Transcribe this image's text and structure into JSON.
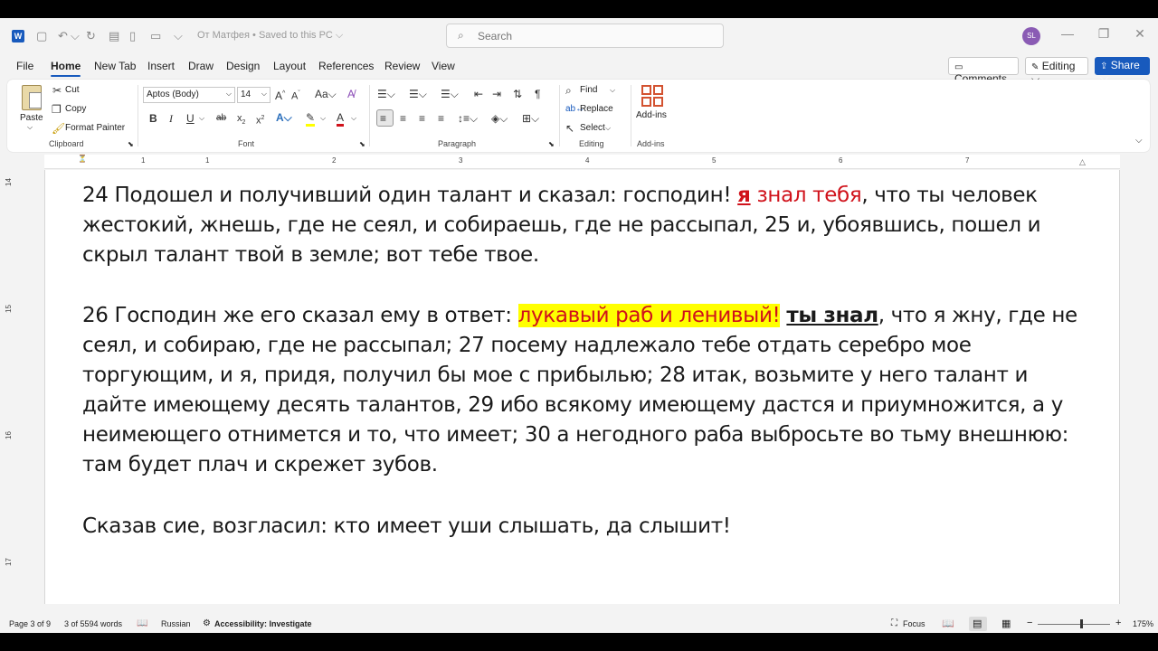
{
  "title_bar": {
    "doc_title": "От Матфея  •  Saved to this PC ⌵",
    "search_placeholder": "Search",
    "avatar_initials": "SL"
  },
  "menu": {
    "tabs": [
      "File",
      "Home",
      "New Tab",
      "Insert",
      "Draw",
      "Design",
      "Layout",
      "References",
      "Review",
      "View"
    ],
    "active_tab": "Home",
    "comments_label": "Comments",
    "editing_label": "Editing ⌵",
    "share_label": "Share ⌵"
  },
  "ribbon": {
    "clipboard": {
      "paste": "Paste",
      "cut": "Cut",
      "copy": "Copy",
      "format_painter": "Format Painter",
      "group_label": "Clipboard"
    },
    "font": {
      "font_name": "Aptos (Body)",
      "font_size": "14",
      "group_label": "Font"
    },
    "paragraph": {
      "group_label": "Paragraph"
    },
    "editing": {
      "find": "Find",
      "replace": "Replace",
      "select": "Select",
      "group_label": "Editing"
    },
    "addins": {
      "button": "Add-ins",
      "group_label": "Add-ins"
    }
  },
  "ruler": {
    "h_numbers": [
      "1",
      "1",
      "2",
      "3",
      "4",
      "5",
      "6",
      "7"
    ],
    "v_numbers": [
      "14",
      "15",
      "16",
      "17"
    ]
  },
  "document": {
    "p1": {
      "a": "24 Подошел и получивший один талант и сказал: господин! ",
      "b": "я",
      "c": " знал тебя",
      "d": ", что ты человек жестокий, жнешь, где не сеял, и собираешь, где не рассыпал, 25 и, убоявшись, пошел и скрыл талант твой в земле; вот тебе твое."
    },
    "p2": {
      "a": "26 Господин же его сказал ему в ответ: ",
      "b": "лукавый раб и ленивый!",
      "c": " ",
      "d": "ты знал",
      "e": ", что я жну, где не сеял, и собираю, где не рассыпал; 27 посему надлежало тебе отдать серебро мое торгующим, и я, придя, получил бы мое с прибылью; 28 итак, возьмите у него талант и дайте имеющему десять талантов, 29 ибо всякому имеющему дастся и приумножится, а у неимеющего отнимется и то, что имеет; 30 а негодного раба выбросьте во тьму внешнюю: там будет плач и скрежет зубов."
    },
    "p3": "Сказав сие, возгласил: кто имеет уши слышать, да слышит!"
  },
  "status": {
    "page": "Page 3 of 9",
    "words": "3 of 5594 words",
    "language": "Russian",
    "accessibility": "Accessibility: Investigate",
    "focus": "Focus",
    "zoom": "175%"
  },
  "colors": {
    "accent": "#185abd",
    "red_text": "#d0121b",
    "highlight": "#ffff00"
  }
}
